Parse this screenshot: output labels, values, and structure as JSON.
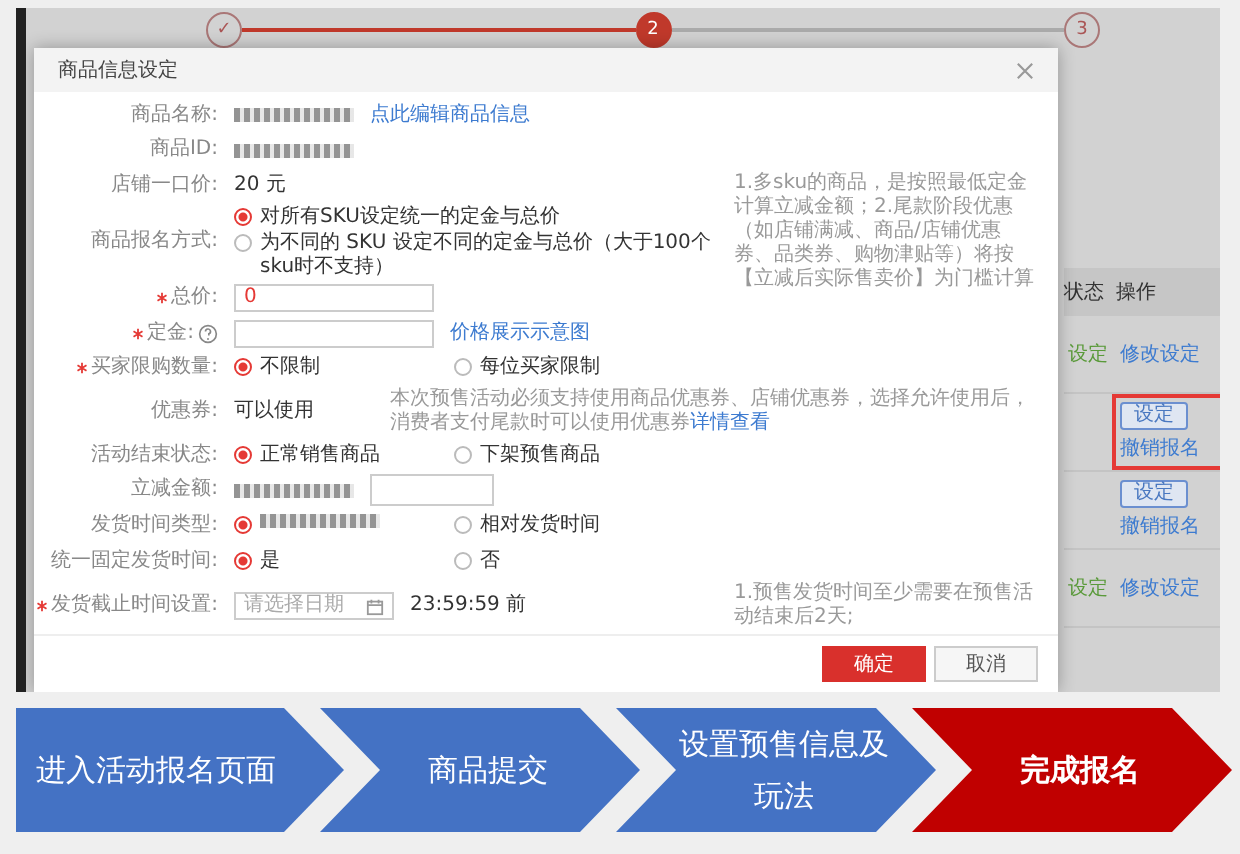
{
  "background": {
    "steps": [
      {
        "label": "✓",
        "done": true,
        "selected": false
      },
      {
        "label": "2",
        "done": false,
        "selected": true
      },
      {
        "label": "3",
        "done": false,
        "selected": false
      }
    ],
    "table": {
      "columns": [
        "状态",
        "操作"
      ],
      "rows": [
        {
          "status": "设定",
          "actions": [
            {
              "kind": "link",
              "label": "修改设定"
            }
          ],
          "highlighted": false
        },
        {
          "actions": [
            {
              "kind": "button",
              "label": "设定"
            },
            {
              "kind": "link",
              "label": "撤销报名"
            }
          ],
          "highlighted": true
        },
        {
          "actions": [
            {
              "kind": "button",
              "label": "设定"
            },
            {
              "kind": "link",
              "label": "撤销报名"
            }
          ],
          "highlighted": false
        },
        {
          "status": "设定",
          "actions": [
            {
              "kind": "link",
              "label": "修改设定"
            }
          ],
          "highlighted": false
        }
      ]
    }
  },
  "dialog": {
    "title": "商品信息设定",
    "fields": [
      {
        "label": "商品名称:",
        "kind": "text",
        "redacted": true,
        "link": "点此编辑商品信息"
      },
      {
        "label": "商品ID:",
        "kind": "text",
        "redacted": true
      },
      {
        "label": "店铺一口价:",
        "kind": "text",
        "value": "20 元"
      },
      {
        "label": "商品报名方式:",
        "kind": "radio",
        "stacked": true,
        "options": [
          {
            "label": "对所有SKU设定统一的定金与总价",
            "selected": true
          },
          {
            "label": "为不同的 SKU 设定不同的定金与总价（大于100个sku时不支持）",
            "selected": false
          }
        ],
        "note": "1.多sku的商品，是按照最低定金计算立减金额；2.尾款阶段优惠（如店铺满减、商品/店铺优惠券、品类券、购物津贴等）将按【立减后实际售卖价】为门槛计算"
      },
      {
        "label": "总价:",
        "required": true,
        "kind": "input",
        "value": "0"
      },
      {
        "label": "定金:",
        "required": true,
        "help": true,
        "kind": "input",
        "link": "价格展示示意图"
      },
      {
        "label": "买家限购数量:",
        "required": true,
        "kind": "radio",
        "options": [
          {
            "label": "不限制",
            "selected": true
          },
          {
            "label": "每位买家限制",
            "selected": false
          }
        ]
      },
      {
        "label": "优惠券:",
        "kind": "text",
        "value": "可以使用",
        "note": "本次预售活动必须支持使用商品优惠券、店铺优惠券，选择允许使用后，消费者支付尾款时可以使用优惠券",
        "note_link": "详情查看",
        "inline_note": true
      },
      {
        "label": "活动结束状态:",
        "kind": "radio",
        "options": [
          {
            "label": "正常销售商品",
            "selected": true
          },
          {
            "label": "下架预售商品",
            "selected": false
          }
        ]
      },
      {
        "label": "立减金额:",
        "kind": "text",
        "redacted": true,
        "input": true
      },
      {
        "label": "发货时间类型:",
        "kind": "radio",
        "options": [
          {
            "redacted": true,
            "selected": true
          },
          {
            "label": "相对发货时间",
            "selected": false
          }
        ]
      },
      {
        "label": "统一固定发货时间:",
        "kind": "radio",
        "options": [
          {
            "label": "是",
            "selected": true
          },
          {
            "label": "否",
            "selected": false
          }
        ]
      },
      {
        "label": "发货截止时间设置:",
        "required": true,
        "kind": "date",
        "placeholder": "请选择日期",
        "suffix": "23:59:59 前",
        "note": "1.预售发货时间至少需要在预售活动结束后2天;"
      }
    ],
    "buttons": [
      {
        "label": "确定",
        "primary": true
      },
      {
        "label": "取消",
        "primary": false
      }
    ]
  },
  "process": [
    {
      "label": "进入活动报名页面",
      "selected": false
    },
    {
      "label": "商品提交",
      "selected": false
    },
    {
      "label": "设置预售信息及玩法",
      "selected": false
    },
    {
      "label": "完成报名",
      "selected": true
    }
  ]
}
